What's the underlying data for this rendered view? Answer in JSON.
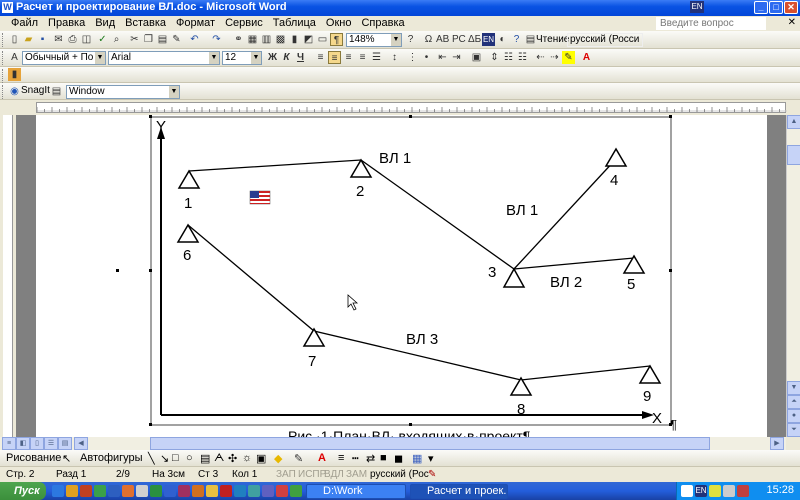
{
  "window": {
    "title": "Расчет и проектирование ВЛ.doc - Microsoft Word",
    "app_icon": "W"
  },
  "menu": [
    "Файл",
    "Правка",
    "Вид",
    "Вставка",
    "Формат",
    "Сервис",
    "Таблица",
    "Окно",
    "Справка"
  ],
  "ask_placeholder": "Введите вопрос",
  "lang_indicator": "EN",
  "toolbar_standard": {
    "zoom": "148%",
    "lang_badge": "EN",
    "reading_label": "Чтение",
    "language": "русский (Росси"
  },
  "toolbar_format": {
    "style": "Обычный + По це",
    "font": "Arial",
    "size": "12",
    "bold": "Ж",
    "italic": "К",
    "underline": "Ч"
  },
  "snagit": {
    "label": "SnagIt",
    "target": "Window"
  },
  "figure": {
    "y_axis": "Y",
    "x_axis": "X",
    "pilcrow": "¶",
    "caption": "Рис.·1·План·ВЛ·,входящих·в·проект¶",
    "nodes": [
      {
        "id": "n1",
        "label": "1"
      },
      {
        "id": "n2",
        "label": "2"
      },
      {
        "id": "n3",
        "label": "3"
      },
      {
        "id": "n4",
        "label": "4"
      },
      {
        "id": "n5",
        "label": "5"
      },
      {
        "id": "n6",
        "label": "6"
      },
      {
        "id": "n7",
        "label": "7"
      },
      {
        "id": "n8",
        "label": "8"
      },
      {
        "id": "n9",
        "label": "9"
      }
    ],
    "line_labels": {
      "vl1_top": "ВЛ 1",
      "vl1_right": "ВЛ 1",
      "vl2": "ВЛ 2",
      "vl3": "ВЛ 3"
    }
  },
  "drawing_toolbar": {
    "draw": "Рисование",
    "autoshapes": "Автофигуры"
  },
  "status": {
    "page": "Стр. 2",
    "section": "Разд 1",
    "pages": "2/9",
    "at": "На 3см",
    "line": "Ст 3",
    "col": "Кол 1",
    "rec": "ЗАП",
    "trk": "ИСПР",
    "ext": "ВДЛ",
    "ovr": "ЗАМ",
    "language": "русский (Рос"
  },
  "taskbar": {
    "start": "Пуск",
    "tasks": [
      {
        "label": "D:\\Work",
        "active": false
      },
      {
        "label": "Расчет и проек...",
        "active": true
      }
    ],
    "tray_lang": "EN",
    "clock": "15:28"
  },
  "colors": {
    "titlebar": "#0a53e3",
    "taskbar": "#245edb",
    "start": "#3c8f3c",
    "page": "#ffffff",
    "workspace": "#808080"
  }
}
